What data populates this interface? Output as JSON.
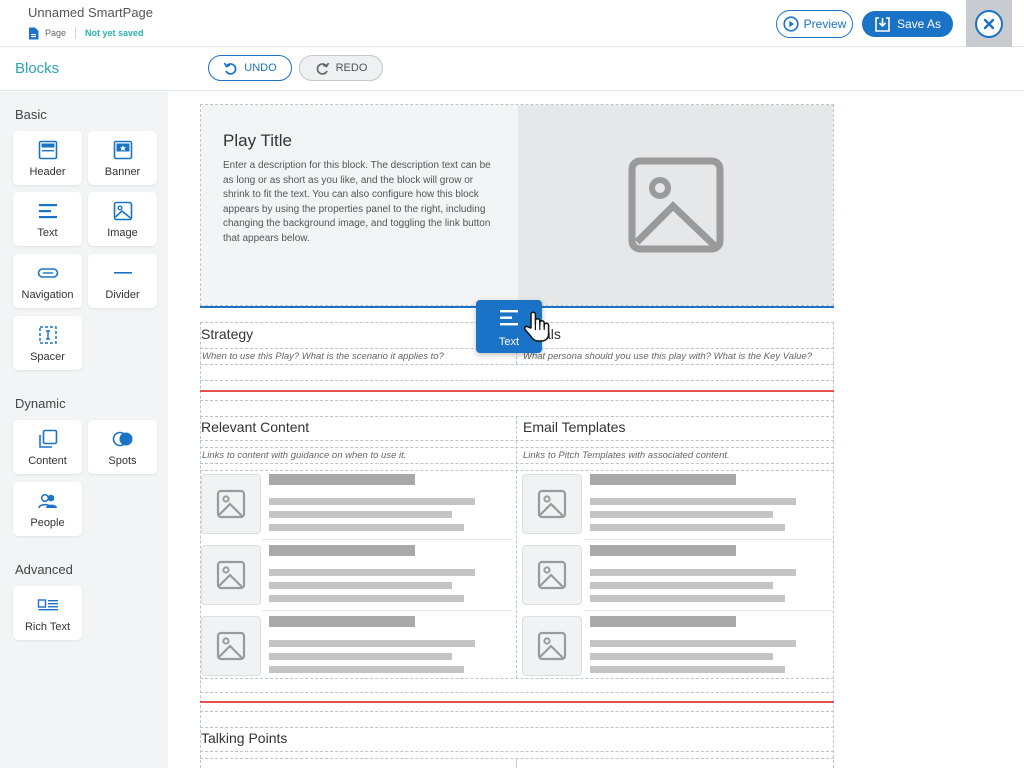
{
  "header": {
    "doc_title": "Unnamed SmartPage",
    "doc_type": "Page",
    "save_state": "Not yet saved",
    "preview_label": "Preview",
    "save_as_label": "Save As"
  },
  "toolbar": {
    "undo_label": "UNDO",
    "redo_label": "REDO"
  },
  "sidebar": {
    "title": "Blocks",
    "sections": {
      "basic": {
        "label": "Basic",
        "items": [
          {
            "label": "Header",
            "icon": "header-icon"
          },
          {
            "label": "Banner",
            "icon": "banner-icon"
          },
          {
            "label": "Text",
            "icon": "text-icon"
          },
          {
            "label": "Image",
            "icon": "image-icon"
          },
          {
            "label": "Navigation",
            "icon": "navigation-icon"
          },
          {
            "label": "Divider",
            "icon": "divider-icon"
          },
          {
            "label": "Spacer",
            "icon": "spacer-icon"
          }
        ]
      },
      "dynamic": {
        "label": "Dynamic",
        "items": [
          {
            "label": "Content",
            "icon": "content-icon"
          },
          {
            "label": "Spots",
            "icon": "spots-icon"
          },
          {
            "label": "People",
            "icon": "people-icon"
          }
        ]
      },
      "advanced": {
        "label": "Advanced",
        "items": [
          {
            "label": "Rich Text",
            "icon": "rich-text-icon"
          }
        ]
      }
    }
  },
  "canvas": {
    "hero": {
      "title": "Play Title",
      "description": "Enter a description for this block. The description text can be as long or as short as you like, and the block will grow or shrink to fit the text. You can also configure how this block appears by using the properties panel to the right, including changing the background image, and toggling the link button that appears below."
    },
    "strategy": {
      "title": "Strategy",
      "subtitle": "When to use this Play? What is the scenario it applies to?"
    },
    "goals": {
      "title": "als",
      "subtitle": "What persona should you use this play with? What is the Key Value?"
    },
    "relevant_content": {
      "title": "Relevant Content",
      "subtitle": "Links to content with guidance on when to use it."
    },
    "email_templates": {
      "title": "Email Templates",
      "subtitle": "Links to Pitch Templates with associated content."
    },
    "talking_points": {
      "title": "Talking Points"
    },
    "drag_ghost_label": "Text"
  },
  "colors": {
    "accent": "#1b73c7",
    "teal": "#2aa5b3",
    "drop_indicator": "#e4504c"
  }
}
